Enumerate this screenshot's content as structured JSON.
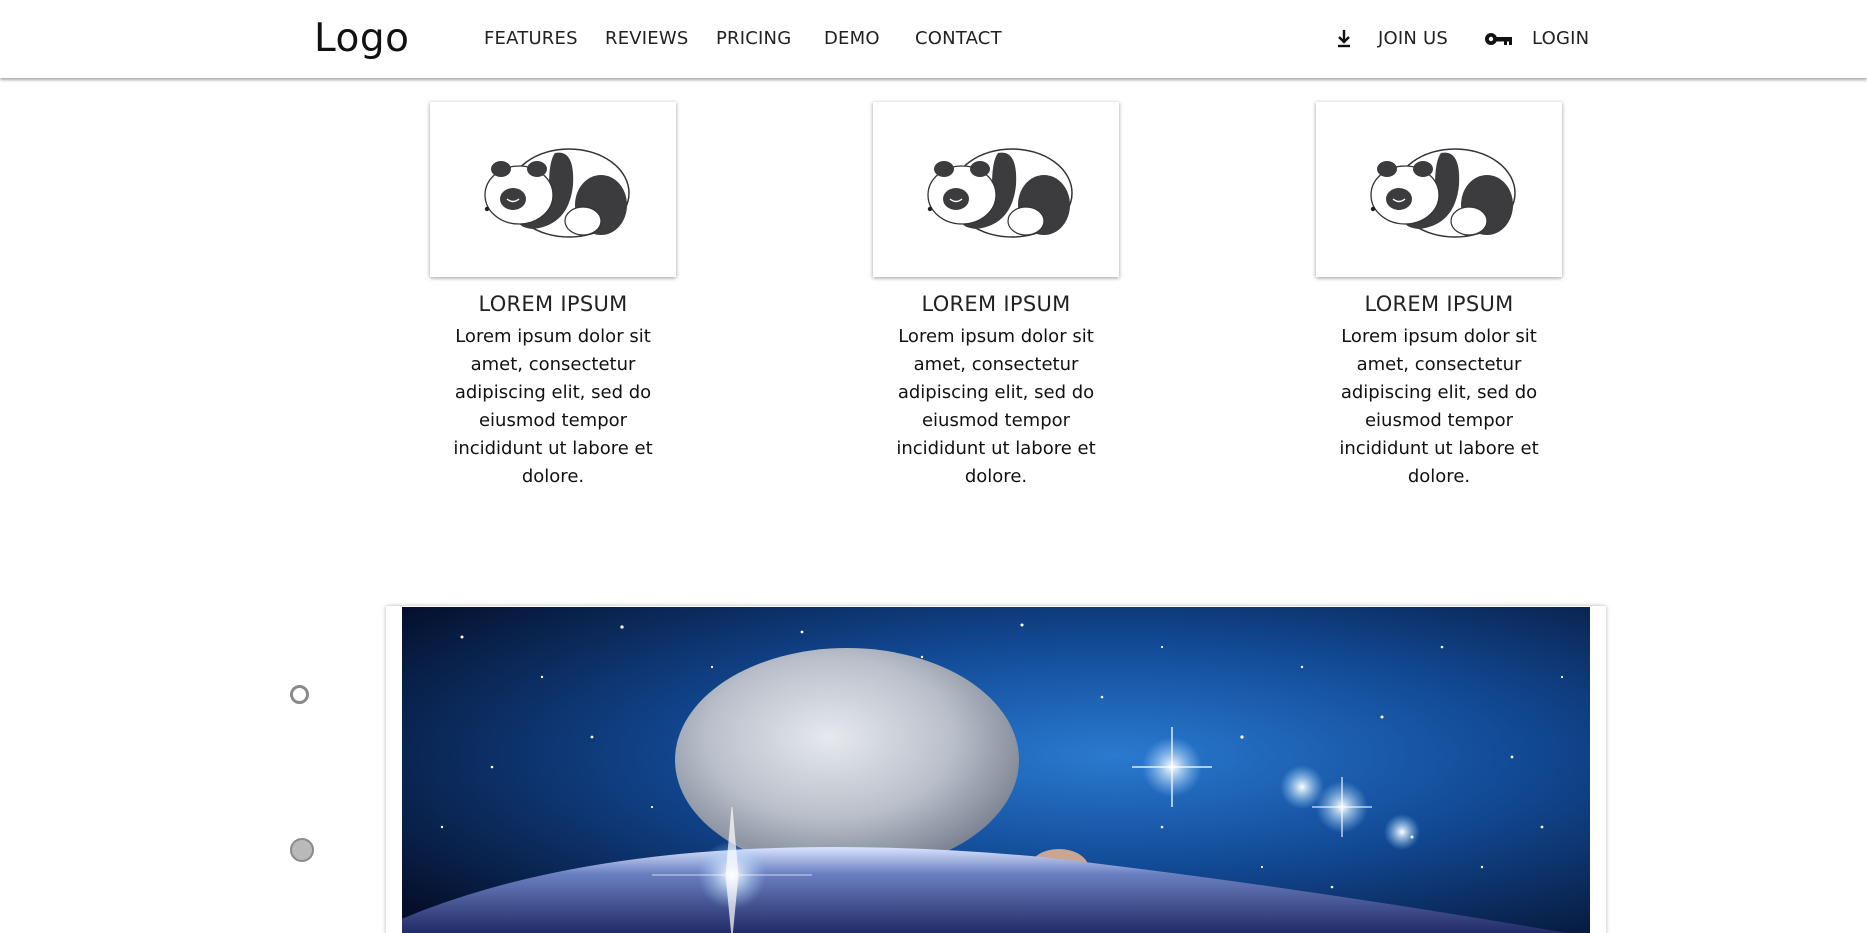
{
  "header": {
    "logo": "Logo",
    "nav": {
      "features": "FEATURES",
      "reviews": "REVIEWS",
      "pricing": "PRICING",
      "demo": "DEMO",
      "contact": "CONTACT"
    },
    "actions": {
      "join": {
        "label": "JOIN US",
        "icon": "download-icon"
      },
      "login": {
        "label": "LOGIN",
        "icon": "key-icon"
      }
    }
  },
  "features": [
    {
      "title": "LOREM IPSUM",
      "text": "Lorem ipsum dolor sit amet, consectetur adipiscing elit, sed do eiusmod tempor incididunt ut labore et dolore.",
      "image": "sleeping-panda"
    },
    {
      "title": "LOREM IPSUM",
      "text": "Lorem ipsum dolor sit amet, consectetur adipiscing elit, sed do eiusmod tempor incididunt ut labore et dolore.",
      "image": "sleeping-panda"
    },
    {
      "title": "LOREM IPSUM",
      "text": "Lorem ipsum dolor sit amet, consectetur adipiscing elit, sed do eiusmod tempor incididunt ut labore et dolore.",
      "image": "sleeping-panda"
    }
  ],
  "slider": {
    "image": "space-scene-moon-and-stars",
    "indicators": [
      {
        "state": "unselected"
      },
      {
        "state": "selected"
      }
    ]
  },
  "colors": {
    "text": "#222222",
    "header_bg": "#ffffff",
    "indicator_border": "#8a8a8a",
    "indicator_fill": "#b9b9b9",
    "space_dark": "#06122e",
    "space_blue": "#1c5fb0"
  }
}
